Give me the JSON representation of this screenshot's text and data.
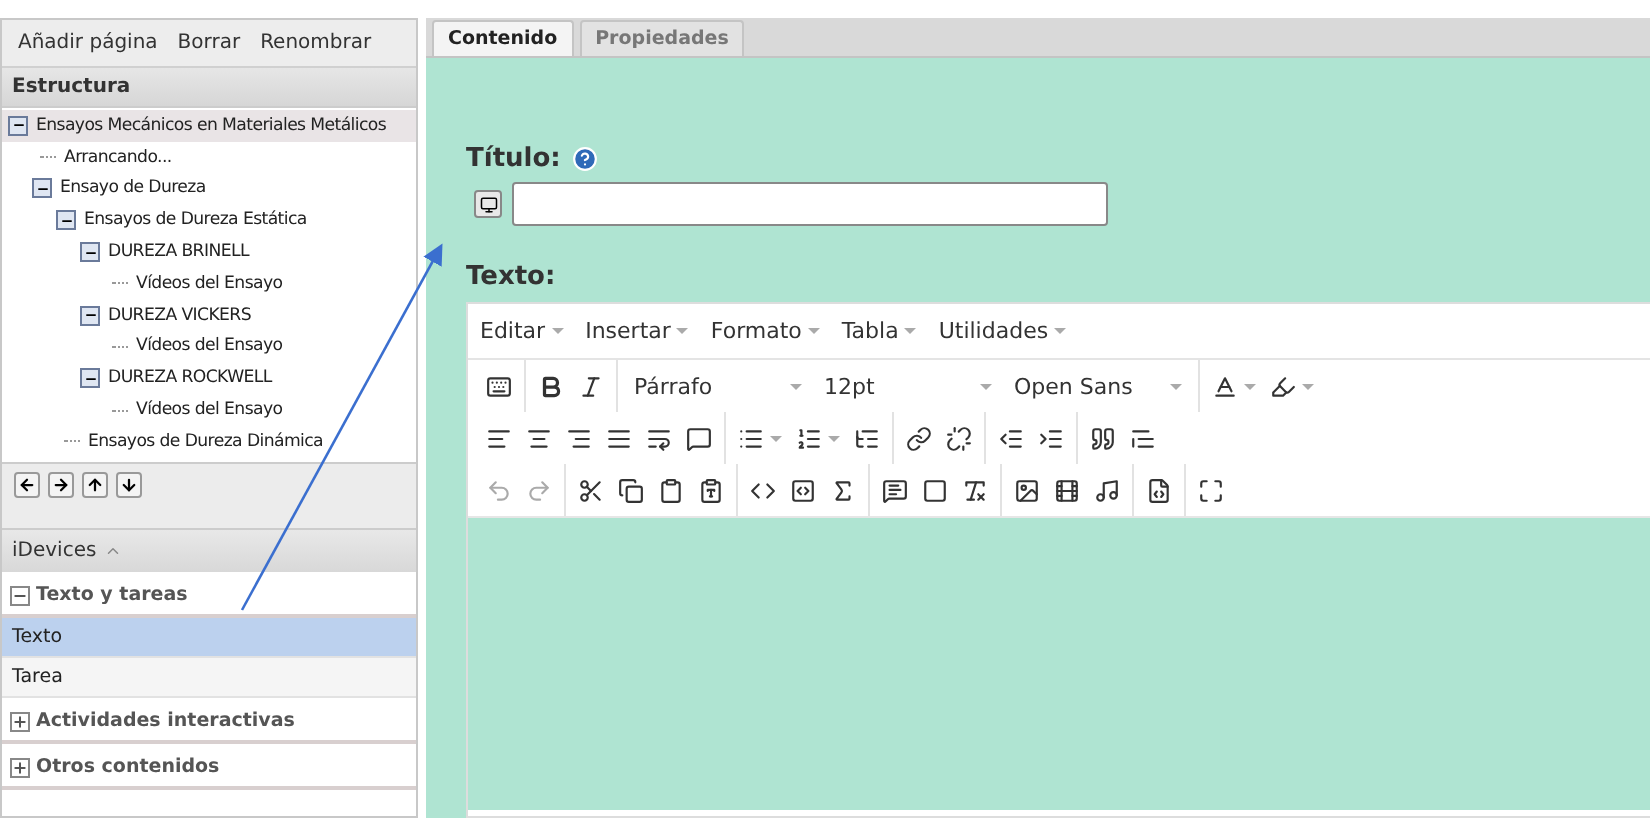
{
  "structure_toolbar": {
    "buttons": [
      "Añadir página",
      "Borrar",
      "Renombrar"
    ]
  },
  "structure": {
    "title": "Estructura",
    "tree": [
      {
        "label": "Ensayos Mecánicos en Materiales Metálicos",
        "expanded": true,
        "selected": true,
        "children": [
          {
            "label": "Arrancando...",
            "selected": false
          },
          {
            "label": "Ensayo de Dureza",
            "expanded": true,
            "selected": false,
            "children": [
              {
                "label": "Ensayos de Dureza Estática",
                "expanded": true,
                "selected": false,
                "children": [
                  {
                    "label": "DUREZA BRINELL",
                    "expanded": true,
                    "selected": false,
                    "children": [
                      {
                        "label": "Vídeos del Ensayo",
                        "selected": false
                      }
                    ]
                  },
                  {
                    "label": "DUREZA VICKERS",
                    "expanded": true,
                    "selected": false,
                    "children": [
                      {
                        "label": "Vídeos del Ensayo",
                        "selected": false
                      }
                    ]
                  },
                  {
                    "label": "DUREZA ROCKWELL",
                    "expanded": true,
                    "selected": false,
                    "children": [
                      {
                        "label": "Vídeos del Ensayo",
                        "selected": false
                      }
                    ]
                  }
                ]
              },
              {
                "label": "Ensayos de Dureza Dinámica",
                "selected": false
              }
            ]
          }
        ]
      }
    ]
  },
  "idevices": {
    "title": "iDevices",
    "categories": [
      {
        "label": "Texto y tareas",
        "expanded": true,
        "items": [
          {
            "label": "Texto",
            "selected": true
          },
          {
            "label": "Tarea",
            "selected": false
          }
        ]
      },
      {
        "label": "Actividades interactivas",
        "expanded": false
      },
      {
        "label": "Otros contenidos",
        "expanded": false
      }
    ]
  },
  "tabs": [
    {
      "label": "Contenido",
      "selected": true
    },
    {
      "label": "Propiedades",
      "selected": false
    }
  ],
  "form": {
    "title_label": "Título:",
    "text_label": "Texto:"
  },
  "editor": {
    "menus": [
      "Editar",
      "Insertar",
      "Formato",
      "Tabla",
      "Utilidades"
    ],
    "block_format": "Párrafo",
    "font_size": "12pt",
    "font_family": "Open Sans"
  }
}
